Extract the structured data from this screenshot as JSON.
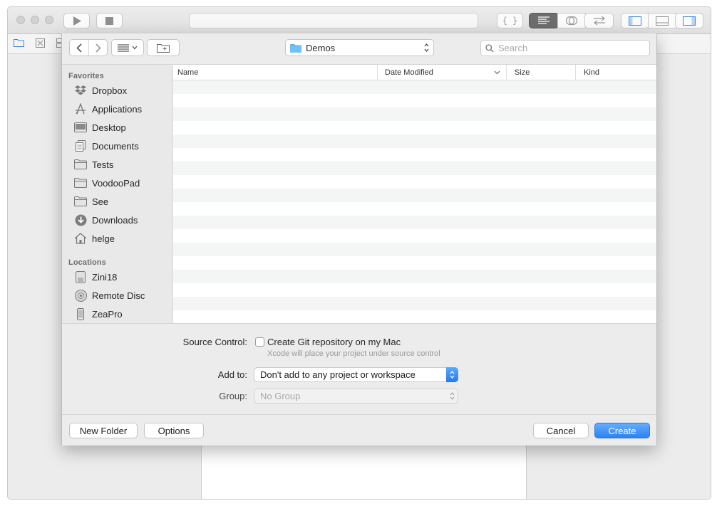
{
  "xcode": {
    "toolbar_icons": [
      "play-icon",
      "stop-icon",
      "braces-icon",
      "standard-editor-icon",
      "assistant-editor-icon",
      "version-editor-icon",
      "navigator-toggle-icon",
      "debug-area-toggle-icon",
      "utilities-toggle-icon"
    ],
    "navigator_icons": [
      "folder-icon",
      "source-control-icon",
      "symbol-icon"
    ]
  },
  "sheet": {
    "path_popup": {
      "label": "Demos",
      "icon": "folder-icon"
    },
    "search": {
      "placeholder": "Search",
      "value": ""
    },
    "sidebar": {
      "favorites_header": "Favorites",
      "favorites": [
        {
          "label": "Dropbox",
          "icon": "dropbox-icon"
        },
        {
          "label": "Applications",
          "icon": "applications-icon"
        },
        {
          "label": "Desktop",
          "icon": "desktop-icon"
        },
        {
          "label": "Documents",
          "icon": "documents-icon"
        },
        {
          "label": "Tests",
          "icon": "folder-icon"
        },
        {
          "label": "VoodooPad",
          "icon": "folder-icon"
        },
        {
          "label": "See",
          "icon": "folder-icon"
        },
        {
          "label": "Downloads",
          "icon": "downloads-icon"
        },
        {
          "label": "helge",
          "icon": "home-icon"
        }
      ],
      "locations_header": "Locations",
      "locations": [
        {
          "label": "Zini18",
          "icon": "disk-icon"
        },
        {
          "label": "Remote Disc",
          "icon": "remote-disc-icon"
        },
        {
          "label": "ZeaPro",
          "icon": "device-icon"
        }
      ]
    },
    "list": {
      "columns": [
        "Name",
        "Date Modified",
        "Size",
        "Kind"
      ],
      "sort_column": "Date Modified"
    },
    "source_control": {
      "label": "Source Control:",
      "checkbox_label": "Create Git repository on my Mac",
      "checked": false,
      "hint": "Xcode will place your project under source control"
    },
    "add_to": {
      "label": "Add to:",
      "value": "Don't add to any project or workspace"
    },
    "group": {
      "label": "Group:",
      "value": "No Group"
    },
    "buttons": {
      "new_folder": "New Folder",
      "options": "Options",
      "cancel": "Cancel",
      "create": "Create"
    }
  }
}
